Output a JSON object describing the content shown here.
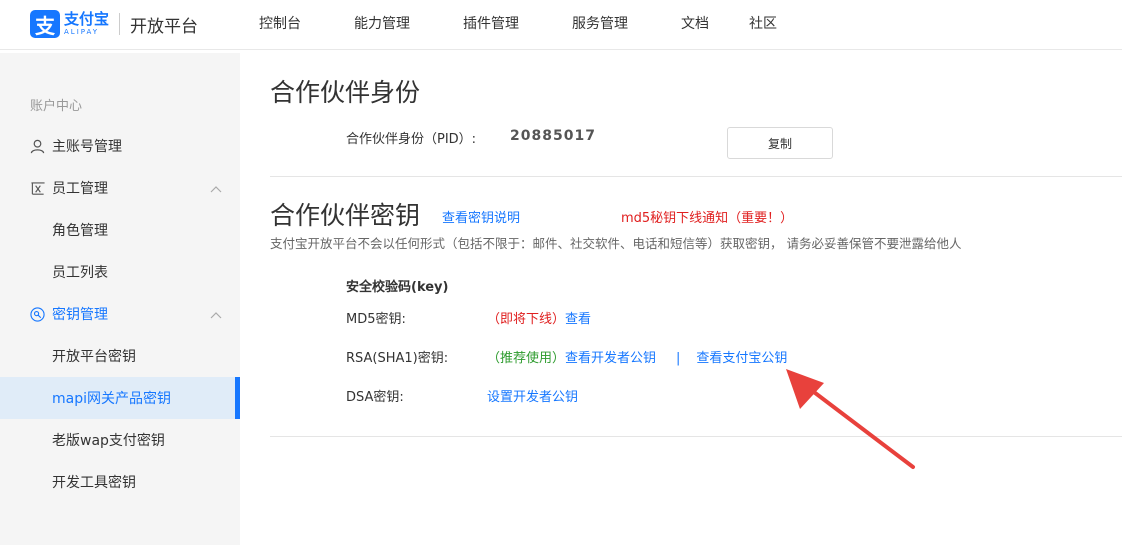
{
  "header": {
    "logo_cn": "支付宝",
    "logo_en": "ALIPAY",
    "logo_sub": "开放平台",
    "nav": [
      "控制台",
      "能力管理",
      "插件管理",
      "服务管理",
      "文档",
      "社区"
    ]
  },
  "sidebar": {
    "section_label": "账户中心",
    "items": {
      "main_account": "主账号管理",
      "staff": "员工管理",
      "role": "角色管理",
      "staff_list": "员工列表",
      "key_mgmt": "密钥管理",
      "open_key": "开放平台密钥",
      "mapi_key": "mapi网关产品密钥",
      "wap_key": "老版wap支付密钥",
      "dev_tool_key": "开发工具密钥"
    }
  },
  "partner_identity": {
    "title": "合作伙伴身份",
    "pid_label": "合作伙伴身份（PID）:",
    "pid_value": "20885017",
    "copy_label": "复制"
  },
  "partner_key": {
    "title": "合作伙伴密钥",
    "help_link": "查看密钥说明",
    "notice": "md5秘钥下线通知（重要！）",
    "description": "支付宝开放平台不会以任何形式（包括不限于：邮件、社交软件、电话和短信等）获取密钥， 请务必妥善保管不要泄露给他人",
    "section_title": "安全校验码(key)",
    "md5_label": "MD5密钥:",
    "md5_status": "（即将下线）",
    "md5_view": "查看",
    "rsa_label": "RSA(SHA1)密钥:",
    "rsa_status": "（推荐使用）",
    "rsa_view_dev": "查看开发者公钥",
    "rsa_sep": "|",
    "rsa_view_alipay": "查看支付宝公钥",
    "dsa_label": "DSA密钥:",
    "dsa_set": "设置开发者公钥"
  },
  "colors": {
    "brand": "#1677ff",
    "notice": "#e02020",
    "recommend": "#2d9b2d",
    "arrow": "#e8413c"
  }
}
